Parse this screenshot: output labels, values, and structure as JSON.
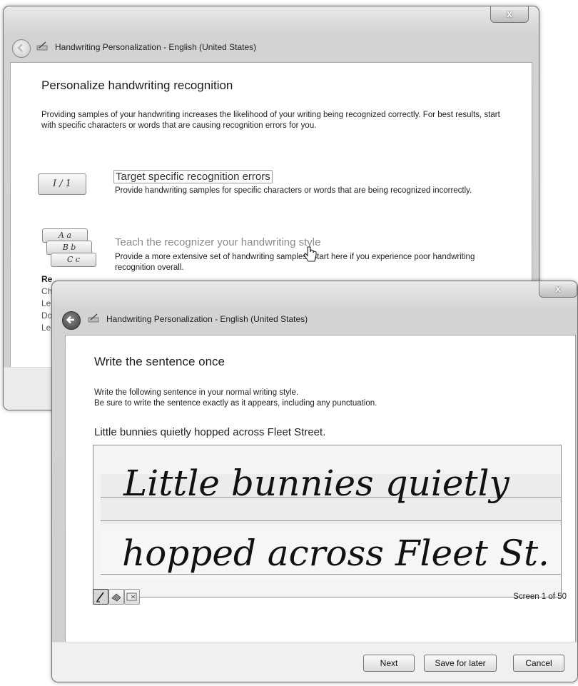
{
  "back_window": {
    "title": "Handwriting Personalization - English (United States)",
    "close_glyph": "x",
    "heading": "Personalize handwriting recognition",
    "intro": "Providing samples of your handwriting increases the likelihood of your writing being recognized correctly. For best results, start with specific characters or words that are causing recognition errors for you.",
    "options": [
      {
        "title": "Target specific recognition errors",
        "description": "Provide handwriting samples for specific characters or words that are being recognized incorrectly.",
        "icon": "character-grid-icon",
        "icon_text": "I / 1"
      },
      {
        "title": "Teach the recognizer your handwriting style",
        "description": "Provide a more extensive set of handwriting samples. Start here if you experience poor handwriting recognition overall.",
        "icon": "stacked-cards-icon",
        "icon_text": [
          "A a",
          "B b",
          "C c"
        ]
      }
    ],
    "cut_off_lines": [
      "Re",
      "Ch",
      "Le",
      "Do",
      "Le"
    ]
  },
  "front_window": {
    "title": "Handwriting Personalization - English (United States)",
    "close_glyph": "x",
    "heading": "Write the sentence once",
    "instructions": [
      "Write the following sentence in your normal writing style.",
      "Be sure to write the sentence exactly as it appears, including any punctuation."
    ],
    "sentence": "Little bunnies quietly hopped across Fleet Street.",
    "ink_lines": [
      "Little bunnies quietly",
      "hopped across Fleet St."
    ],
    "tools": [
      {
        "name": "pen-icon",
        "active": true
      },
      {
        "name": "eraser-icon",
        "active": false
      },
      {
        "name": "clear-icon",
        "active": false
      }
    ],
    "screen_counter": "Screen 1 of 50",
    "buttons": {
      "next": "Next",
      "save_for_later": "Save for later",
      "cancel": "Cancel"
    }
  }
}
